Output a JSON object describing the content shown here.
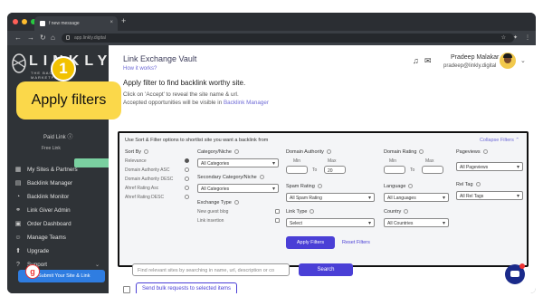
{
  "browser": {
    "tab_title": "f new message",
    "url": "app.linkly.digital"
  },
  "logo": {
    "text": "LINKLY",
    "tagline": "THE BACKLINK MARKETPLACE"
  },
  "sidebar": {
    "paid_link": "Paid Link",
    "free_link": "Free Link",
    "items": [
      {
        "label": "My Sites & Partners",
        "icon": "grid-icon"
      },
      {
        "label": "Backlink Manager",
        "icon": "table-icon"
      },
      {
        "label": "Backlink Monitor",
        "icon": "monitor-icon"
      },
      {
        "label": "Link Giver Admin",
        "icon": "link-icon"
      },
      {
        "label": "Order Dashboard",
        "icon": "dashboard-icon"
      },
      {
        "label": "Manage Teams",
        "icon": "team-icon"
      },
      {
        "label": "Upgrade",
        "icon": "upgrade-icon"
      },
      {
        "label": "Support",
        "icon": "support-icon"
      }
    ],
    "submit_button": "Submit Your Site & Link"
  },
  "header": {
    "title": "Link Exchange Vault",
    "how_it_works": "How it works?",
    "user_name": "Pradeep Malakar",
    "user_email": "pradeep@linkly.digital"
  },
  "intro": {
    "heading": "Apply filter to find backlink worthy site.",
    "line1": "Click on 'Accept' to reveal the site name & url.",
    "line2_prefix": "Accepted opportunities will be visible in ",
    "line2_link": "Backlink Manager"
  },
  "filters": {
    "hint": "Use Sort & Filter options to shortlist site you want a backlink from",
    "collapse": "Collapse Filters",
    "sort_by": {
      "label": "Sort By",
      "options": [
        "Relevance",
        "Domain Authority ASC",
        "Domain Authority DESC",
        "Ahref Rating Asc",
        "Ahref Rating DESC"
      ],
      "selected_index": 0
    },
    "category": {
      "label": "Category/Niche",
      "value": "All Categories"
    },
    "secondary_category": {
      "label": "Secondary Category/Niche",
      "value": "All Categories"
    },
    "exchange_type": {
      "label": "Exchange Type",
      "options": [
        "New guest blog",
        "Link insertion"
      ]
    },
    "domain_authority": {
      "label": "Domain Authority",
      "min_label": "Min",
      "max_label": "Max",
      "to": "To",
      "min": "",
      "max": "20"
    },
    "domain_rating": {
      "label": "Domain Rating",
      "min_label": "Min",
      "max_label": "Max",
      "to": "To",
      "min": "",
      "max": ""
    },
    "pageviews": {
      "label": "Pageviews",
      "value": "All Pageviews"
    },
    "spam_rating": {
      "label": "Spam Rating",
      "value": "All Spam Rating"
    },
    "language": {
      "label": "Language",
      "value": "All Languages"
    },
    "rel_tag": {
      "label": "Rel Tag",
      "value": "All Rel Tags"
    },
    "link_type": {
      "label": "Link Type",
      "value": "Select"
    },
    "country": {
      "label": "Country",
      "value": "All Countries"
    },
    "apply_button": "Apply Filters",
    "reset": "Reset Filters"
  },
  "search": {
    "placeholder": "Find relevant sites by searching in name, url, description or co",
    "button": "Search"
  },
  "bulk": {
    "button": "Send bulk requests to selected items"
  },
  "overlay": {
    "number": "1",
    "label": "Apply filters"
  },
  "colors": {
    "accent": "#4a3fd6",
    "callout": "#fbd84a",
    "sidebar": "#2f3337"
  }
}
